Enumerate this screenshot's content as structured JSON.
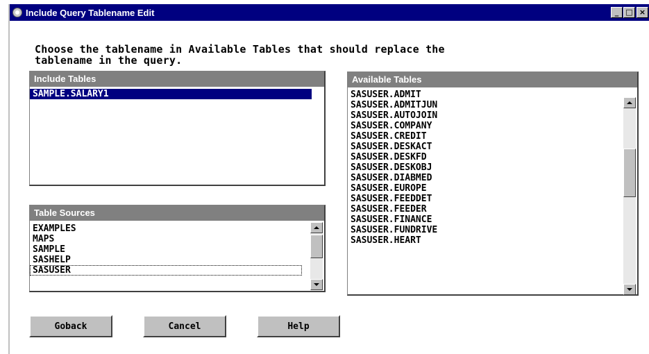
{
  "window": {
    "title": "Include Query Tablename Edit",
    "minimize_label": "_",
    "maximize_label": "□",
    "close_label": "×"
  },
  "instructions": {
    "line1": "Choose the tablename in Available Tables that should replace the",
    "line2": "tablename in the query."
  },
  "include_tables": {
    "header": "Include Tables",
    "items": [
      "SAMPLE.SALARY1"
    ],
    "selected_index": 0
  },
  "table_sources": {
    "header": "Table Sources",
    "items": [
      "EXAMPLES",
      "MAPS",
      "SAMPLE",
      "SASHELP",
      "SASUSER"
    ],
    "focused_index": 4
  },
  "available_tables": {
    "header": "Available Tables",
    "items": [
      "SASUSER.ADMIT",
      "SASUSER.ADMITJUN",
      "SASUSER.AUTOJOIN",
      "SASUSER.COMPANY",
      "SASUSER.CREDIT",
      "SASUSER.DESKACT",
      "SASUSER.DESKFD",
      "SASUSER.DESKOBJ",
      "SASUSER.DIABMED",
      "SASUSER.EUROPE",
      "SASUSER.FEEDDET",
      "SASUSER.FEEDER",
      "SASUSER.FINANCE",
      "SASUSER.FUNDRIVE",
      "SASUSER.HEART"
    ]
  },
  "buttons": {
    "goback": "Goback",
    "cancel": "Cancel",
    "help": "Help"
  },
  "colors": {
    "titlebar": "#000080",
    "selection": "#000080",
    "list_header": "#808080",
    "button_face": "#c0c0c0"
  }
}
